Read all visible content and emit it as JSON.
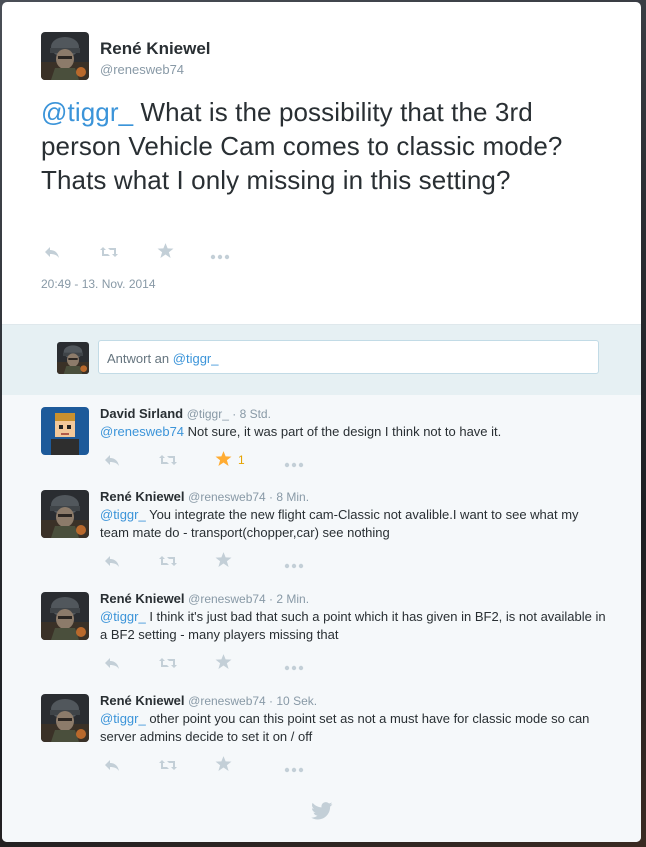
{
  "main": {
    "author_name": "René Kniewel",
    "author_handle": "@renesweb74",
    "text_mention": "@tiggr_",
    "text_body": " What is the possibility that the 3rd person Vehicle Cam comes to classic mode? Thats what I only missing in this setting?",
    "timestamp": "20:49 - 13. Nov. 2014",
    "icons": [
      "reply-icon",
      "retweet-icon",
      "favorite-icon",
      "more-icon"
    ]
  },
  "reply_box": {
    "placeholder_prefix": "Antwort an ",
    "placeholder_mention": "@tiggr_"
  },
  "replies": [
    {
      "name": "David Sirland",
      "meta": "@tiggr_ · 8 Std.",
      "mention": "@renesweb74",
      "text": " Not sure, it was part of the design I think not to have it.",
      "favorite_count": "1",
      "favorited": true,
      "avatar": "pixel-avatar"
    },
    {
      "name": "René Kniewel",
      "meta": "@renesweb74 · 8 Min.",
      "mention": "@tiggr_",
      "text": "  You integrate the new flight cam-Classic not avalible.I want to see what my team mate do - transport(chopper,car) see nothing",
      "avatar": "soldier-avatar"
    },
    {
      "name": "René Kniewel",
      "meta": "@renesweb74 · 2 Min.",
      "mention": "@tiggr_",
      "text": " I think it's just bad that such a point which it has given in BF2, is not available in a BF2 setting  - many players missing that",
      "avatar": "soldier-avatar"
    },
    {
      "name": "René Kniewel",
      "meta": "@renesweb74 · 10 Sek.",
      "mention": "@tiggr_",
      "text": " other point you can this point set as not a must have for classic mode so can server admins decide to set it on / off",
      "avatar": "soldier-avatar"
    }
  ],
  "footer": {
    "icon": "twitter-bird-icon"
  },
  "colors": {
    "link": "#3b94d9",
    "favorite": "#ffac33",
    "icon": "#c3cfd7"
  }
}
